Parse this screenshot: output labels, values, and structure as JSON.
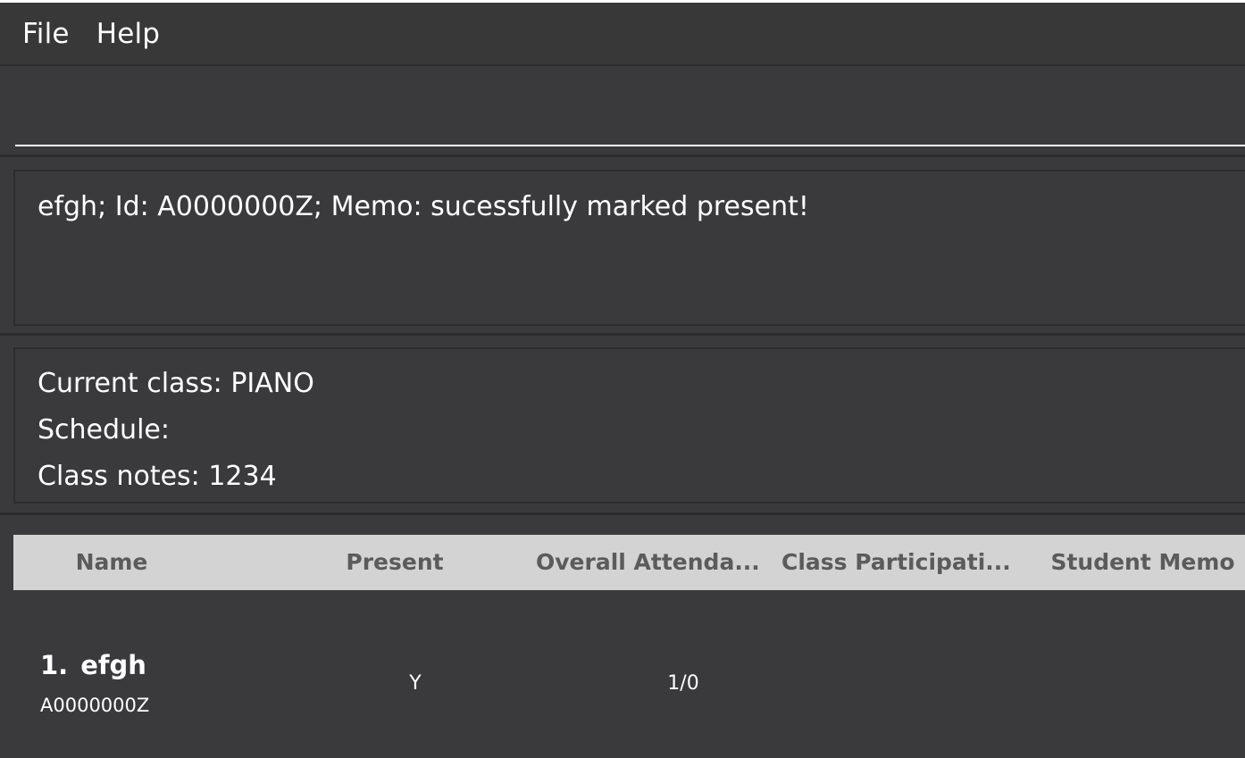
{
  "menu": {
    "items": [
      {
        "label": "File"
      },
      {
        "label": "Help"
      }
    ]
  },
  "command": {
    "value": "",
    "placeholder": ""
  },
  "result": {
    "message": "efgh; Id: A0000000Z; Memo:  sucessfully marked present!"
  },
  "class_info": {
    "current_class": "Current class: PIANO",
    "schedule": "Schedule:",
    "class_notes": "Class notes: 1234"
  },
  "table": {
    "columns": [
      "Name",
      "Present",
      "Overall Attenda...",
      "Class Participati...",
      "Student Memo"
    ],
    "rows": [
      {
        "index": "1.",
        "name": "efgh",
        "id": "A0000000Z",
        "present": "Y",
        "overall_attendance": "1/0",
        "class_participation": "",
        "student_memo": ""
      }
    ]
  },
  "colors": {
    "background": "#3a3a3c",
    "menubar": "#383838",
    "table_header": "#d3d3d3",
    "table_header_text": "#5b5b5b",
    "text": "#ffffff"
  }
}
